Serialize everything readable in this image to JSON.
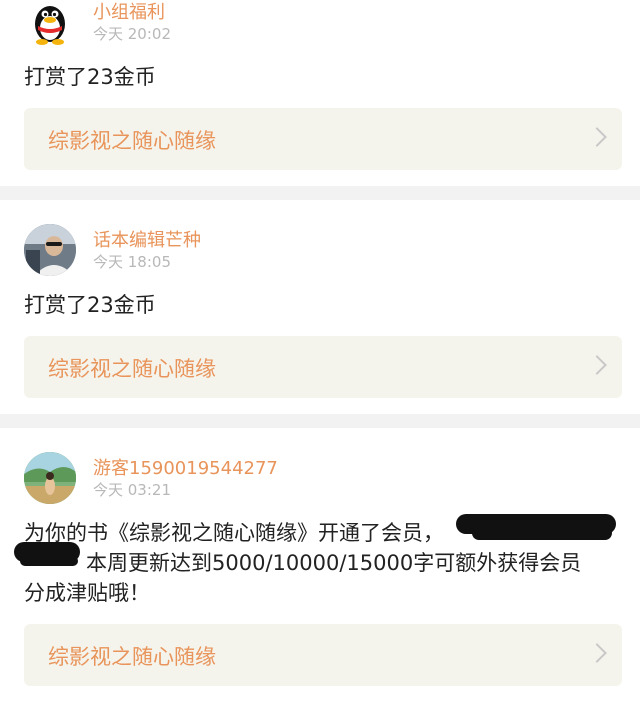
{
  "feed": {
    "items": [
      {
        "name": "小组福利",
        "time": "今天 20:02",
        "message": "打赏了23金币",
        "book_title": "综影视之随心随缘",
        "avatar_icon": "qq-penguin-avatar"
      },
      {
        "name": "话本编辑芒种",
        "time": "今天 18:05",
        "message": "打赏了23金币",
        "book_title": "综影视之随心随缘",
        "avatar_icon": "person-photo-avatar"
      },
      {
        "name": "游客1590019544277",
        "time": "今天 03:21",
        "message_line1": "为你的书《综影视之随心随缘》开通了会员，",
        "message_line2": "本周更新达到5000/10000/15000字可额外获得会员",
        "message_line3": "分成津贴哦！",
        "book_title": "综影视之随心随缘",
        "avatar_icon": "game-scene-avatar"
      }
    ]
  },
  "colors": {
    "accent": "#e8945a",
    "time": "#b8b8b8",
    "link_bg": "#f5f4ec",
    "separator": "#f2f2f2"
  }
}
